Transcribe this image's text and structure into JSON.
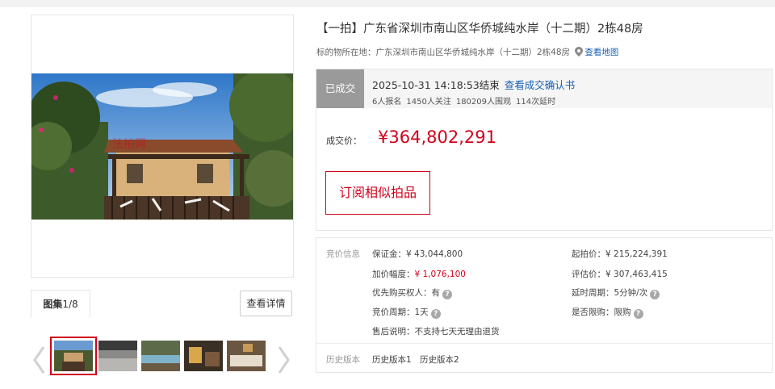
{
  "gallery": {
    "counter_label": "图集",
    "counter_value": "1/8",
    "detail_button": "查看详情",
    "thumbnails": [
      "house-exterior",
      "interior-hall",
      "pool-view",
      "living-room",
      "bedroom"
    ]
  },
  "header": {
    "title": "【一拍】广东省深圳市南山区华侨城纯水岸（十二期）2栋48房",
    "location_label": "标的物所在地：",
    "location_value": "广东深圳市南山区华侨城纯水岸（十二期）2栋48房",
    "map_link": "查看地图"
  },
  "status": {
    "badge": "已成交",
    "end_time": "2025-10-31 14:18:53结束",
    "cert_link": "查看成交确认书",
    "stats": [
      "6人报名",
      "1450人关注",
      "180209人围观",
      "114次延时"
    ],
    "deal_label": "成交价：",
    "deal_price": "¥364,802,291",
    "subscribe_button": "订阅相似拍品"
  },
  "bid_info": {
    "section_label": "竞价信息",
    "deposit": "保证金：¥ 43,044,800",
    "increment_label": "加价幅度：",
    "increment_value": "¥ 1,076,100",
    "priority": "优先购买权人：有",
    "cycle": "竞价周期：1天",
    "after_sale": "售后说明：不支持七天无理由退货",
    "start_price": "起拍价：¥ 215,224,391",
    "appraisal": "评估价：¥ 307,463,415",
    "delay_cycle": "延时周期：5分钟/次",
    "purchase_limit": "是否限购：限购"
  },
  "history": {
    "label": "历史版本",
    "versions": [
      "历史版本1",
      "历史版本2"
    ]
  },
  "colors": {
    "accent_red": "#d0021b",
    "link_blue": "#1a5fb4",
    "badge_gray": "#9a9a9a"
  }
}
